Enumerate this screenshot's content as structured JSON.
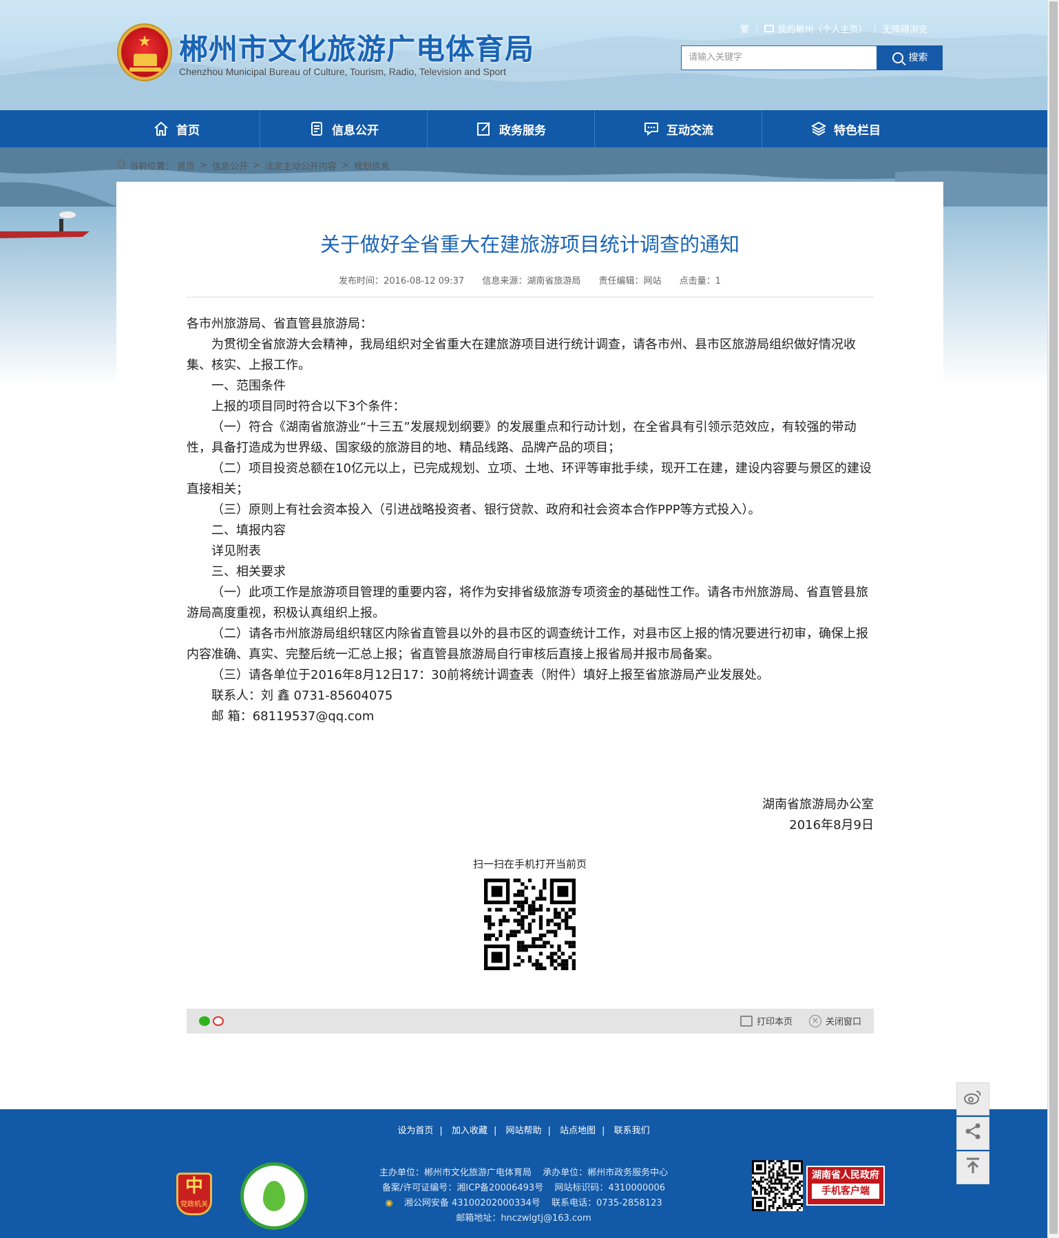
{
  "header": {
    "title": "郴州市文化旅游广电体育局",
    "subtitle": "Chenzhou Municipal Bureau of Culture, Tourism, Radio, Television and Sport",
    "top_links": [
      "繁",
      "我的郴州（个人主页）",
      "无障碍浏览"
    ],
    "search_placeholder": "请输入关键字",
    "search_button": "搜索"
  },
  "nav": [
    {
      "label": "首页",
      "icon": "home-icon"
    },
    {
      "label": "信息公开",
      "icon": "document-icon"
    },
    {
      "label": "政务服务",
      "icon": "edit-icon"
    },
    {
      "label": "互动交流",
      "icon": "chat-icon"
    },
    {
      "label": "特色栏目",
      "icon": "layers-icon"
    }
  ],
  "breadcrumb": {
    "label": "当前位置：",
    "items": [
      "首页",
      "法定主动公开内容",
      "规划信息"
    ],
    "middle": "信息公开"
  },
  "article": {
    "title": "关于做好全省重大在建旅游项目统计调查的通知",
    "meta": {
      "publish_time": "发布时间：2016-08-12 09:37",
      "source": "信息来源：湖南省旅游局",
      "editor": "责任编辑：网站",
      "clicks": "点击量：1"
    },
    "paragraphs": [
      {
        "text": "各市州旅游局、省直管县旅游局：",
        "indent": false
      },
      {
        "text": "为贯彻全省旅游大会精神，我局组织对全省重大在建旅游项目进行统计调查，请各市州、县市区旅游局组织做好情况收集、核实、上报工作。",
        "indent": true
      },
      {
        "text": "一、范围条件",
        "indent": true
      },
      {
        "text": "上报的项目同时符合以下3个条件：",
        "indent": true
      },
      {
        "text": "（一）符合《湖南省旅游业“十三五”发展规划纲要》的发展重点和行动计划，在全省具有引领示范效应，有较强的带动性，具备打造成为世界级、国家级的旅游目的地、精品线路、品牌产品的项目；",
        "indent": true
      },
      {
        "text": "（二）项目投资总额在10亿元以上，已完成规划、立项、土地、环评等审批手续，现开工在建，建设内容要与景区的建设直接相关；",
        "indent": true
      },
      {
        "text": "（三）原则上有社会资本投入（引进战略投资者、银行贷款、政府和社会资本合作PPP等方式投入）。",
        "indent": true
      },
      {
        "text": "二、填报内容",
        "indent": true
      },
      {
        "text": "详见附表",
        "indent": true
      },
      {
        "text": "三、相关要求",
        "indent": true
      },
      {
        "text": "（一）此项工作是旅游项目管理的重要内容，将作为安排省级旅游专项资金的基础性工作。请各市州旅游局、省直管县旅游局高度重视，积极认真组织上报。",
        "indent": true
      },
      {
        "text": "（二）请各市州旅游局组织辖区内除省直管县以外的县市区的调查统计工作，对县市区上报的情况要进行初审，确保上报内容准确、真实、完整后统一汇总上报；省直管县旅游局自行审核后直接上报省局并报市局备案。",
        "indent": true
      },
      {
        "text": "（三）请各单位于2016年8月12日17：30前将统计调查表（附件）填好上报至省旅游局产业发展处。",
        "indent": true
      },
      {
        "text": "联系人：刘 鑫 0731-85604075",
        "indent": true
      },
      {
        "text": "邮 箱：68119537@qq.com",
        "indent": true
      }
    ],
    "signature_org": "湖南省旅游局办公室",
    "signature_date": "2016年8月9日",
    "qr_caption": "扫一扫在手机打开当前页"
  },
  "toolbar": {
    "share_icons": [
      "wechat-icon",
      "weibo-icon"
    ],
    "print": "打印本页",
    "close": "关闭窗口"
  },
  "float_buttons": [
    "weibo-icon",
    "share-icon",
    "back-to-top-icon"
  ],
  "footer": {
    "links": [
      "设为首页",
      "加入收藏",
      "网站帮助",
      "站点地图",
      "联系我们"
    ],
    "sponsor": "主办单位：郴州市文化旅游广电体育局",
    "undertaker": "承办单位：郴州市政务服务中心",
    "icp": "备案/许可证编号：湘ICP备20006493号",
    "site_id": "网站标识码：4310000006",
    "police": "湘公网安备 43100202000334号",
    "phone": "联系电话：0735-2858123",
    "email": "邮箱地址：hnczwlgtj@163.com",
    "gov_badge": "党政机关",
    "app_badge_line1": "湖南省人民政府",
    "app_badge_line2": "手机客户端"
  },
  "colors": {
    "brand_blue": "#1259a7",
    "title_blue": "#1a64b6",
    "footer_blue": "#1259a7"
  }
}
